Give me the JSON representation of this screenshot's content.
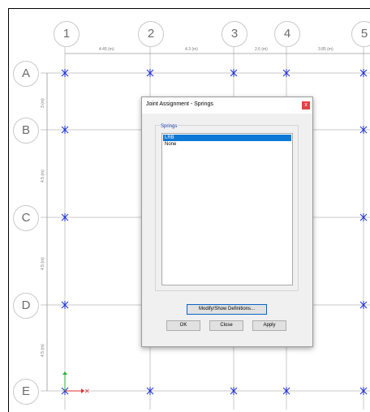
{
  "grid": {
    "columns": [
      "1",
      "2",
      "3",
      "4",
      "5"
    ],
    "rows": [
      "A",
      "B",
      "C",
      "D",
      "E"
    ],
    "col_spacings": [
      "4.45 (m)",
      "4.3 (m)",
      "2.6 (m)",
      "3.85 (m)"
    ],
    "row_spacings": [
      "3 (m)",
      "4.5 (m)",
      "4.5 (m)",
      "4.5 (m)"
    ]
  },
  "axes": {
    "x_color": "#e03030",
    "y_color": "#2fae3a"
  },
  "colors": {
    "joint": "#1a2ed6",
    "grid_line": "#c8c8c8",
    "accent": "#0d78d6"
  },
  "dialog": {
    "title": "Joint Assignment - Springs",
    "close_symbol": "x",
    "group_label": "Springs",
    "items": [
      {
        "label": "LRB",
        "selected": true
      },
      {
        "label": "None",
        "selected": false
      }
    ],
    "modify_button": "Modify/Show Definitions...",
    "ok_button": "OK",
    "close_button": "Close",
    "apply_button": "Apply"
  }
}
